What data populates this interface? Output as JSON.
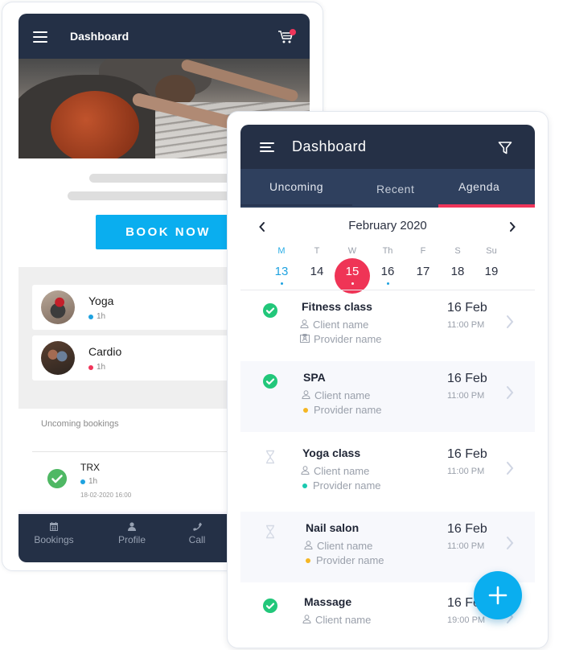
{
  "back_app": {
    "header": {
      "title": "Dashboard",
      "menu_icon": "hamburger-icon",
      "cart_icon": "shopping-cart-icon",
      "cart_badge_color": "#f0355a"
    },
    "hero_image": "yoga-class-photo",
    "book_button": {
      "label": "BOOK NOW",
      "color": "#0aaeef"
    },
    "classes": [
      {
        "name": "Yoga",
        "duration": "1h",
        "dot_color": "#1ea2e0",
        "avatar": "yoga-avatar"
      },
      {
        "name": "Cardio",
        "duration": "1h",
        "dot_color": "#f0355a",
        "avatar": "cardio-avatar"
      }
    ],
    "upcoming": {
      "title": "Uncoming bookings",
      "items": [
        {
          "name": "TRX",
          "duration": "1h",
          "dot_color": "#1ea2e0",
          "datetime": "18-02-2020 16:00",
          "status": "confirmed"
        }
      ]
    },
    "bottom_nav": [
      {
        "label": "Bookings",
        "icon": "calendar-icon"
      },
      {
        "label": "Profile",
        "icon": "user-icon"
      },
      {
        "label": "Call",
        "icon": "phone-icon"
      }
    ]
  },
  "front_app": {
    "header": {
      "title": "Dashboard",
      "menu_icon": "hamburger-icon",
      "filter_icon": "filter-icon"
    },
    "tabs": [
      {
        "label": "Uncoming",
        "active": false
      },
      {
        "label": "Recent",
        "active": false
      },
      {
        "label": "Agenda",
        "active": true
      }
    ],
    "calendar": {
      "month_label": "February 2020",
      "weekdays": [
        "M",
        "T",
        "W",
        "Th",
        "F",
        "S",
        "Su"
      ],
      "days": [
        "13",
        "14",
        "15",
        "16",
        "17",
        "18",
        "19"
      ],
      "today": "13",
      "selected": "15",
      "days_with_events": [
        "13",
        "15",
        "16"
      ]
    },
    "agenda": [
      {
        "title": "Fitness class",
        "client": "Client name",
        "provider": "Provider name",
        "provider_marker": "id-card-icon",
        "date": "16 Feb",
        "time": "11:00 PM",
        "status": "confirmed"
      },
      {
        "title": "SPA",
        "client": "Client name",
        "provider": "Provider name",
        "provider_marker": "#f5b623",
        "date": "16 Feb",
        "time": "11:00 PM",
        "status": "confirmed"
      },
      {
        "title": "Yoga class",
        "client": "Client name",
        "provider": "Provider name",
        "provider_marker": "#19c9b0",
        "date": "16 Feb",
        "time": "11:00 PM",
        "status": "pending"
      },
      {
        "title": "Nail salon",
        "client": "Client name",
        "provider": "Provider name",
        "provider_marker": "#f5b623",
        "date": "16 Feb",
        "time": "11:00 PM",
        "status": "pending"
      },
      {
        "title": "Massage",
        "client": "Client name",
        "date": "16 Feb",
        "time": "19:00 PM",
        "status": "confirmed"
      }
    ],
    "fab": {
      "label": "+",
      "icon": "plus-icon",
      "color": "#0aaeef"
    },
    "colors": {
      "header": "#253046",
      "tabs": "#2f405e",
      "accent": "#ef3456",
      "confirmed": "#22c77a"
    }
  }
}
